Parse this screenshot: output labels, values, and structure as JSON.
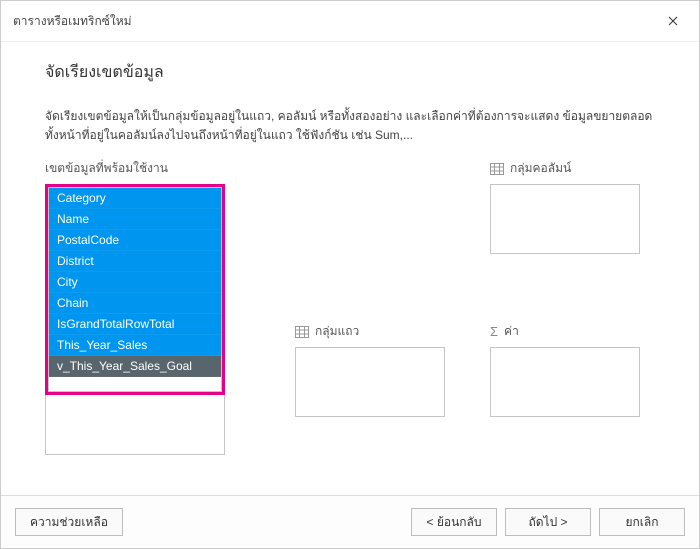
{
  "titlebar": {
    "title": "ตารางหรือเมทริกซ์ใหม่"
  },
  "content": {
    "heading": "จัดเรียงเขตข้อมูล",
    "description": "จัดเรียงเขตข้อมูลให้เป็นกลุ่มข้อมูลอยู่ในแถว, คอลัมน์ หรือทั้งสองอย่าง และเลือกค่าที่ต้องการจะแสดง ข้อมูลขยายตลอดทั้งหน้าที่อยู่ในคอลัมน์ลงไปจนถึงหน้าที่อยู่ในแถว  ใช้ฟังก์ชัน เช่น Sum,..."
  },
  "fields": {
    "available_label": "เขตข้อมูลที่พร้อมใช้งาน",
    "items": [
      "Category",
      "Name",
      "PostalCode",
      "District",
      "City",
      "Chain",
      "IsGrandTotalRowTotal",
      "This_Year_Sales",
      "v_This_Year_Sales_Goal"
    ]
  },
  "zones": {
    "column_groups": "กลุ่มคอลัมน์",
    "row_groups": "กลุ่มแถว",
    "values": "ค่า"
  },
  "footer": {
    "help": "ความช่วยเหลือ",
    "back": "< ย้อนกลับ",
    "next": "ถัดไป >",
    "cancel": "ยกเลิก"
  }
}
